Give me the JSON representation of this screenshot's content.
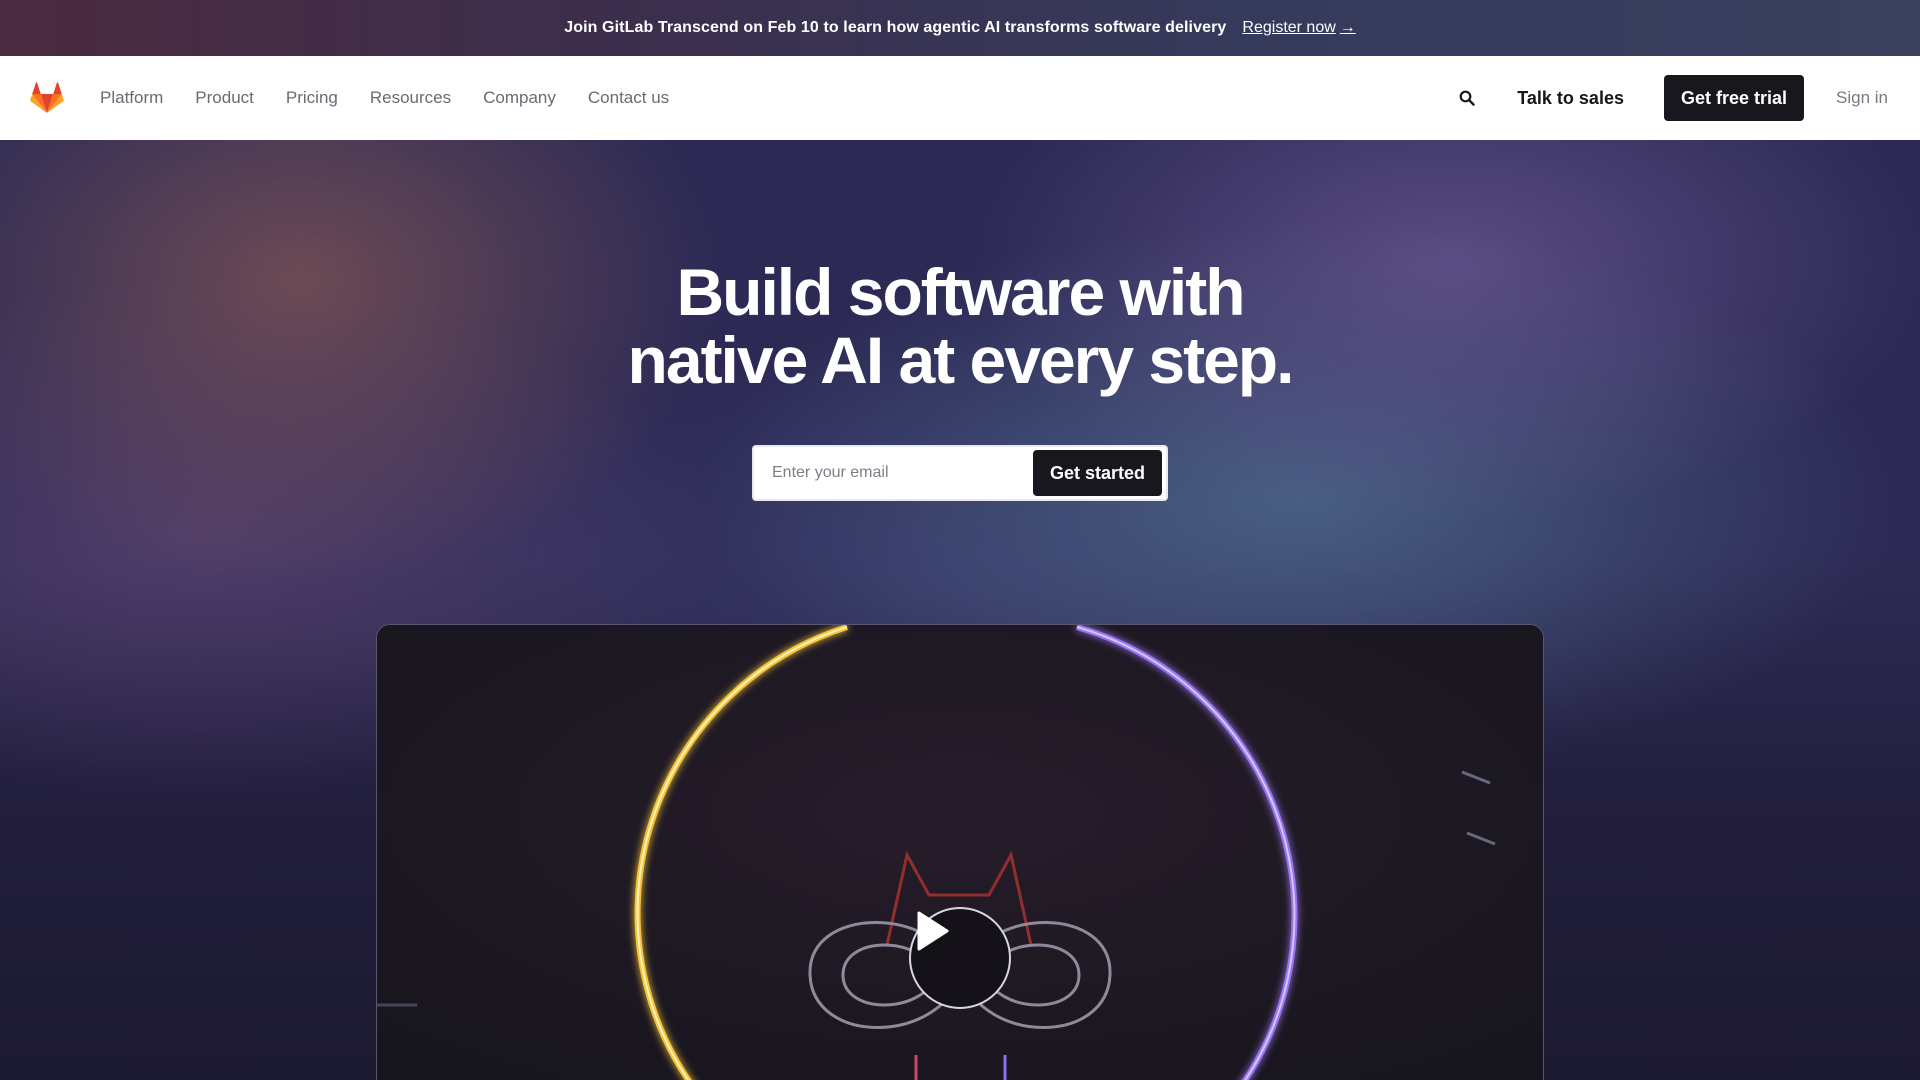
{
  "banner": {
    "text": "Join GitLab Transcend on Feb 10 to learn how agentic AI transforms software delivery",
    "link_label": "Register now",
    "link_arrow": "→"
  },
  "nav": {
    "logo_icon": "gitlab-tanuki-icon",
    "links": [
      "Platform",
      "Product",
      "Pricing",
      "Resources",
      "Company",
      "Contact us"
    ],
    "search_icon": "search-icon",
    "talk_to_sales": "Talk to sales",
    "free_trial": "Get free trial",
    "sign_in": "Sign in"
  },
  "hero": {
    "title_line1": "Build software with",
    "title_line2": "native AI at every step.",
    "email_placeholder": "Enter your email",
    "cta": "Get started"
  },
  "video": {
    "play_icon": "play-icon"
  },
  "colors": {
    "brand_orange": "#fc6d26",
    "brand_dark_orange": "#e24329",
    "button_dark": "#18171d",
    "ring_yellow": "#f5c43a",
    "ring_purple": "#9a74f0"
  }
}
